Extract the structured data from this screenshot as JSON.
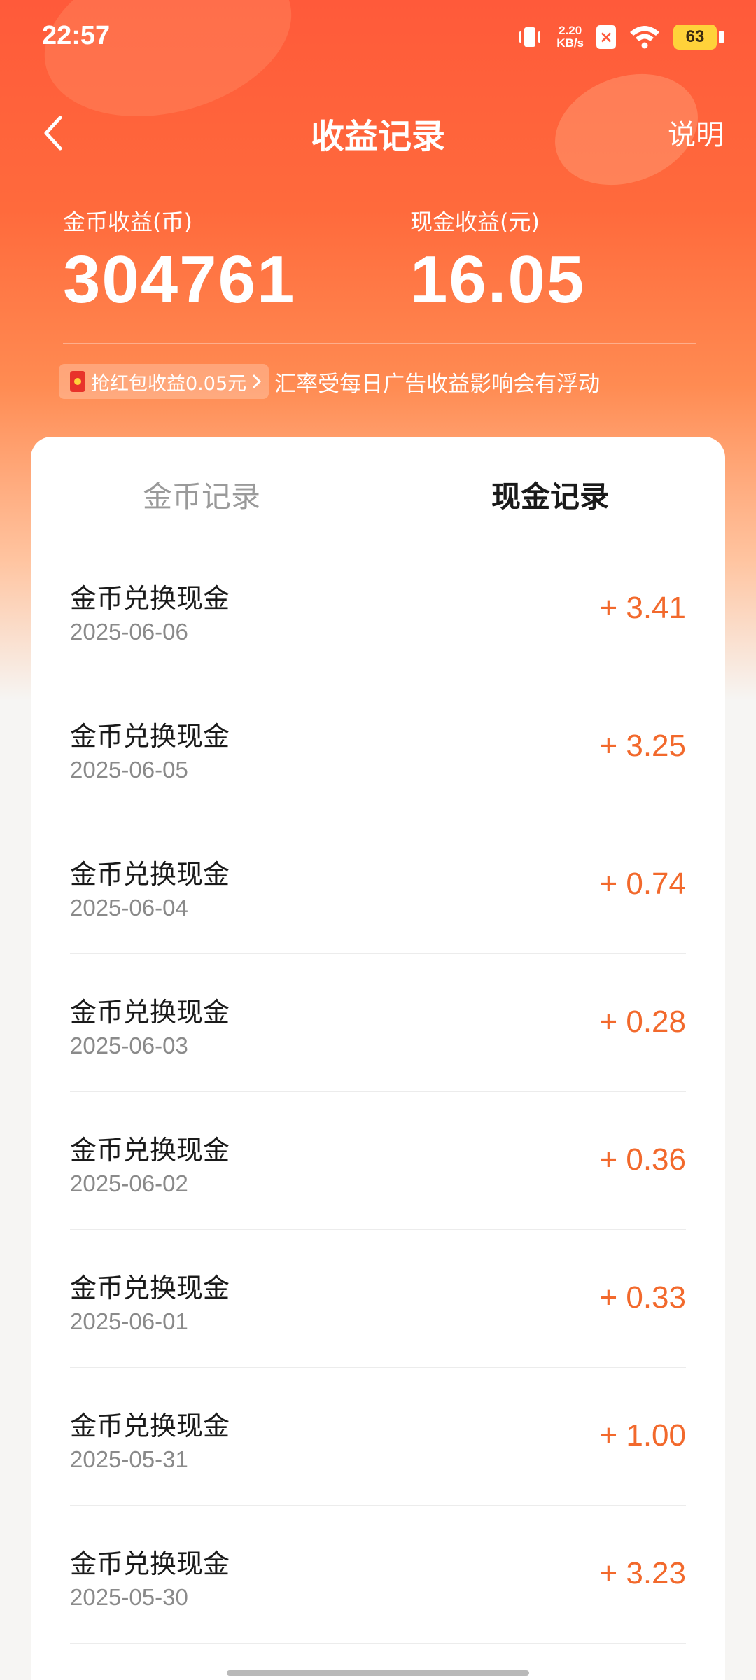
{
  "status_bar": {
    "time": "22:57",
    "net_speed_value": "2.20",
    "net_speed_unit": "KB/s",
    "battery": "63"
  },
  "header": {
    "title": "收益记录",
    "explain_label": "说明"
  },
  "stats": {
    "coin_label": "金币收益(币)",
    "coin_value": "304761",
    "cash_label": "现金收益(元)",
    "cash_value": "16.05"
  },
  "notice": {
    "redpack_label": "抢红包收益0.05元",
    "text": "汇率受每日广告收益影响会有浮动"
  },
  "tabs": {
    "coin_records": "金币记录",
    "cash_records": "现金记录",
    "active": "cash_records"
  },
  "records": [
    {
      "title": "金币兑换现金",
      "date": "2025-06-06",
      "amount": "+ 3.41"
    },
    {
      "title": "金币兑换现金",
      "date": "2025-06-05",
      "amount": "+ 3.25"
    },
    {
      "title": "金币兑换现金",
      "date": "2025-06-04",
      "amount": "+ 0.74"
    },
    {
      "title": "金币兑换现金",
      "date": "2025-06-03",
      "amount": "+ 0.28"
    },
    {
      "title": "金币兑换现金",
      "date": "2025-06-02",
      "amount": "+ 0.36"
    },
    {
      "title": "金币兑换现金",
      "date": "2025-06-01",
      "amount": "+ 0.33"
    },
    {
      "title": "金币兑换现金",
      "date": "2025-05-31",
      "amount": "+ 1.00"
    },
    {
      "title": "金币兑换现金",
      "date": "2025-05-30",
      "amount": "+ 3.23"
    }
  ],
  "colors": {
    "header_gradient_top": "#ff5a3a",
    "amount_color": "#f2692c",
    "battery_color": "#ffd23a"
  },
  "icons": [
    "vibrate-icon",
    "wifi-icon",
    "back-arrow-icon",
    "red-packet-icon",
    "chevron-right-icon"
  ]
}
